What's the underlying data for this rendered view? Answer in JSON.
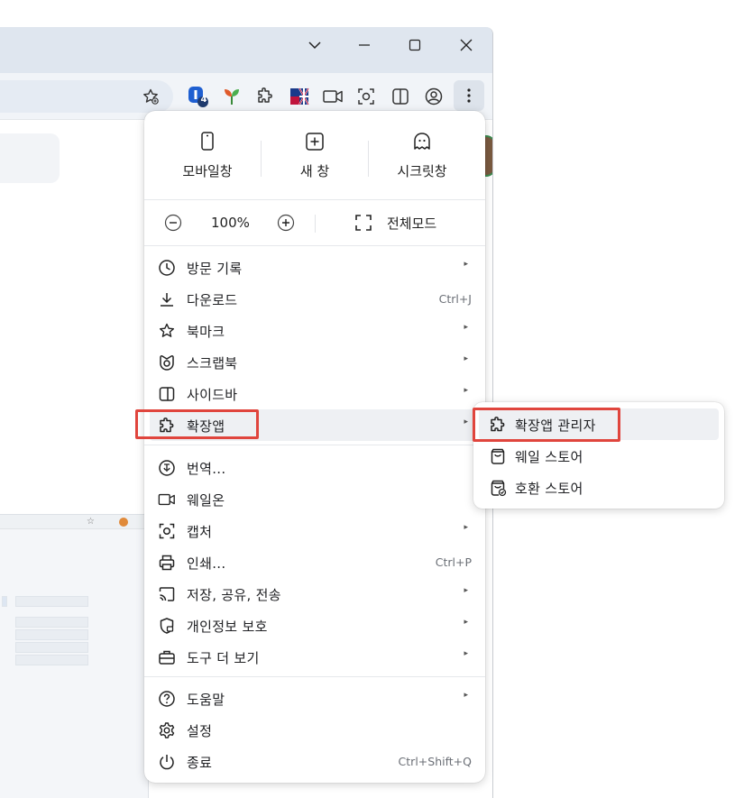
{
  "menu": {
    "top": {
      "mobile_window": "모바일창",
      "new_window": "새 창",
      "secret_window": "시크릿창"
    },
    "zoom": {
      "level": "100%",
      "fullscreen": "전체모드"
    },
    "items": [
      {
        "label": "방문 기록",
        "shortcut": "",
        "icon": "history-icon"
      },
      {
        "label": "다운로드",
        "shortcut": "Ctrl+J",
        "icon": "download-icon"
      },
      {
        "label": "북마크",
        "shortcut": "",
        "icon": "star-icon"
      },
      {
        "label": "스크랩북",
        "shortcut": "",
        "icon": "scrapbook-icon"
      },
      {
        "label": "사이드바",
        "shortcut": "",
        "icon": "sidebar-icon"
      },
      {
        "label": "확장앱",
        "shortcut": "",
        "icon": "puzzle-icon"
      },
      {
        "label": "번역...",
        "shortcut": "",
        "icon": "translate-icon"
      },
      {
        "label": "웨일온",
        "shortcut": "",
        "icon": "video-icon"
      },
      {
        "label": "캡처",
        "shortcut": "",
        "icon": "capture-icon"
      },
      {
        "label": "인쇄...",
        "shortcut": "Ctrl+P",
        "icon": "print-icon"
      },
      {
        "label": "저장, 공유, 전송",
        "shortcut": "",
        "icon": "cast-icon"
      },
      {
        "label": "개인정보 보호",
        "shortcut": "",
        "icon": "privacy-shield-icon"
      },
      {
        "label": "도구 더 보기",
        "shortcut": "",
        "icon": "toolbox-icon"
      },
      {
        "label": "도움말",
        "shortcut": "",
        "icon": "help-icon"
      },
      {
        "label": "설정",
        "shortcut": "",
        "icon": "gear-icon"
      },
      {
        "label": "종료",
        "shortcut": "Ctrl+Shift+Q",
        "icon": "power-icon"
      }
    ]
  },
  "submenu": {
    "items": [
      {
        "label": "확장앱 관리자",
        "icon": "puzzle-icon"
      },
      {
        "label": "웨일 스토어",
        "icon": "store-bag-icon"
      },
      {
        "label": "호환 스토어",
        "icon": "compat-store-icon"
      }
    ]
  },
  "toolbar": {
    "badge_count": "4"
  },
  "colors": {
    "highlight_box": "#e0453d",
    "titlebar": "#dfe6ef",
    "hover": "#eef0f3"
  }
}
